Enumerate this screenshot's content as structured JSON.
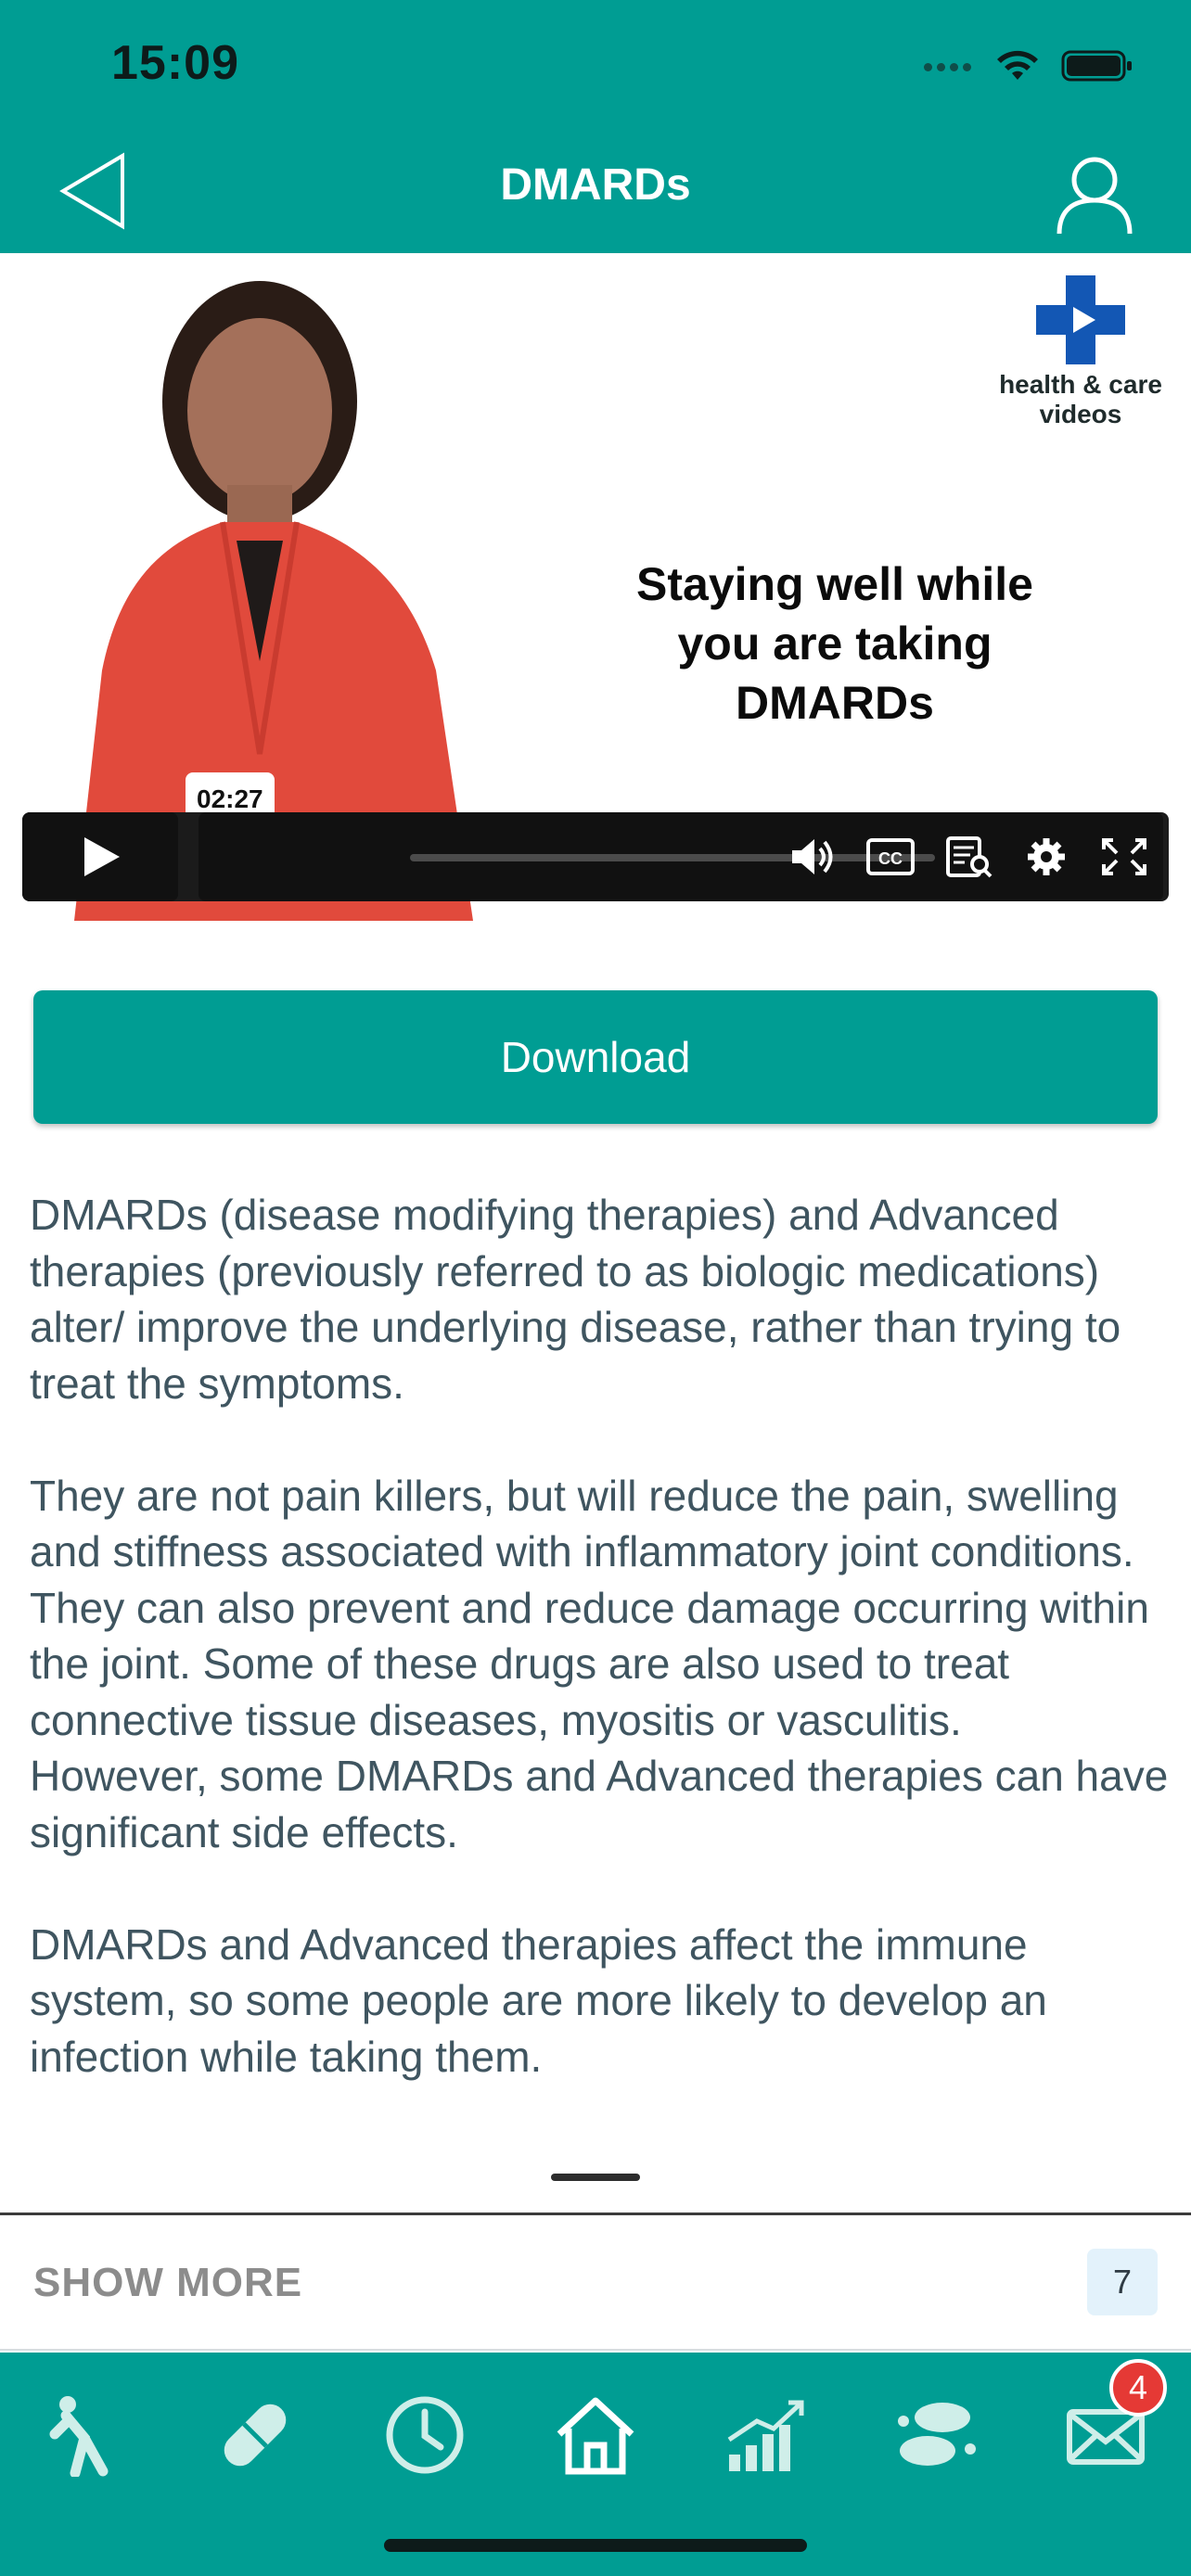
{
  "status_bar": {
    "time": "15:09"
  },
  "header": {
    "title": "DMARDs"
  },
  "video": {
    "brand": [
      "health & care",
      "videos"
    ],
    "caption_lines": [
      "Staying well while",
      "you are taking",
      "DMARDs"
    ],
    "timestamp": "02:27",
    "progress": 0.0,
    "controls": [
      "play-icon",
      "volume-icon",
      "closed-captions-icon",
      "transcript-icon",
      "settings-icon",
      "fullscreen-icon"
    ]
  },
  "download": {
    "label": "Download"
  },
  "article": {
    "p1": "DMARDs (disease modifying therapies) and Advanced therapies (previously referred to as biologic medications) alter/ improve the underlying disease, rather than trying to treat the symptoms.",
    "p2": "They are not pain killers, but will reduce the pain, swelling and stiffness associated with inflammatory joint conditions. They can also prevent and reduce damage occurring within the joint. Some of these drugs are also used to treat connective tissue diseases, myositis or vasculitis.",
    "p3": "However, some DMARDs and Advanced therapies can have significant side effects.",
    "p4": "DMARDs and Advanced therapies affect the immune system, so some people are more likely to develop an infection while taking them."
  },
  "show_more": {
    "label": "SHOW MORE",
    "count": "7"
  },
  "tabbar": {
    "tabs": [
      "exercise-icon",
      "medication-icon",
      "clock-icon",
      "home-icon",
      "progress-chart-icon",
      "footsteps-icon",
      "mail-icon"
    ],
    "mail_badge": "4"
  },
  "colors": {
    "brand": "#009d93",
    "text": "#3f5560",
    "badge": "#e53935"
  }
}
